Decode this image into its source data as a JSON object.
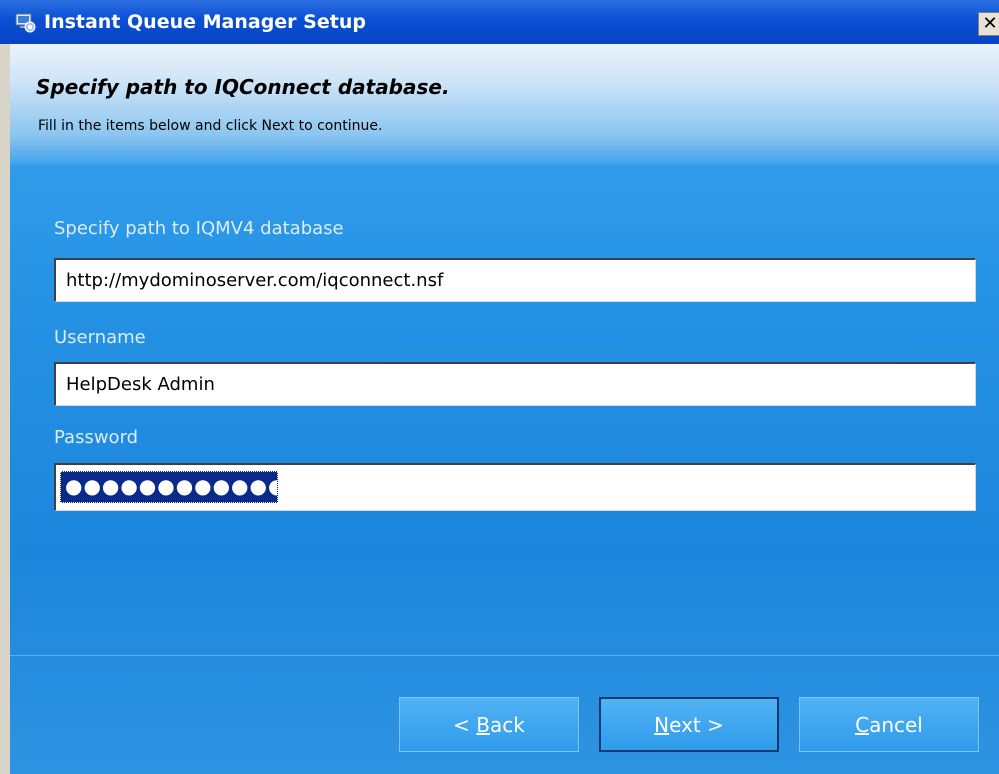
{
  "window": {
    "title": "Instant Queue Manager Setup",
    "close_glyph": "✕"
  },
  "header": {
    "title": "Specify path to IQConnect database.",
    "subtitle": "Fill in the items below and click Next to continue."
  },
  "form": {
    "path_label": "Specify path to IQMV4 database",
    "path_value": "http://mydominoserver.com/iqconnect.nsf",
    "username_label": "Username",
    "username_value": "HelpDesk Admin",
    "password_label": "Password",
    "password_masked": "●●●●●●●●●●●●●●"
  },
  "buttons": {
    "back": {
      "prefix": "< ",
      "accel": "B",
      "rest": "ack"
    },
    "next": {
      "accel": "N",
      "rest": "ext >"
    },
    "cancel": {
      "accel": "C",
      "rest": "ancel"
    }
  },
  "colors": {
    "titlebar": "#0a4fd4",
    "dialog_background": "#2692e4",
    "selection": "#0a2a8a"
  },
  "icons": {
    "app": "installer-computer-icon",
    "close": "close-icon"
  }
}
